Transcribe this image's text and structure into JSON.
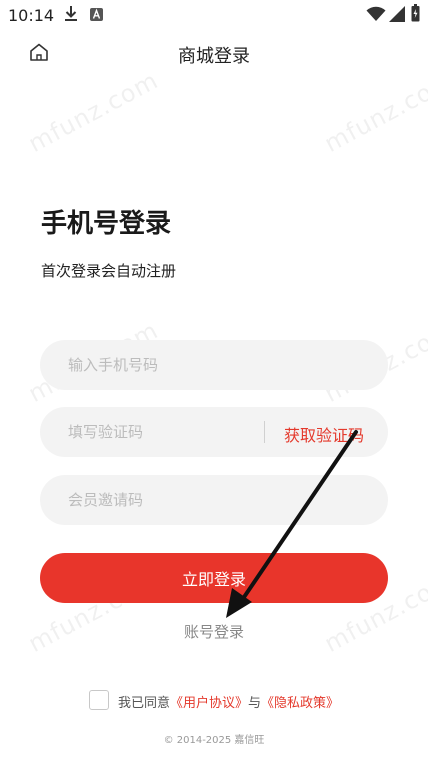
{
  "status_bar": {
    "time": "10:14",
    "icons": [
      "download-icon",
      "a-badge-icon",
      "wifi-icon",
      "signal-icon",
      "battery-icon"
    ]
  },
  "header": {
    "title": "商城登录",
    "home_icon": "home-icon"
  },
  "main": {
    "title": "手机号登录",
    "subtitle": "首次登录会自动注册"
  },
  "form": {
    "phone_placeholder": "输入手机号码",
    "code_placeholder": "填写验证码",
    "get_code_label": "获取验证码",
    "invite_placeholder": "会员邀请码"
  },
  "actions": {
    "login_label": "立即登录",
    "account_login_label": "账号登录"
  },
  "agreement": {
    "prefix": "我已同意",
    "user_agreement": "《用户协议》",
    "conjunction": "与",
    "privacy_policy": "《隐私政策》"
  },
  "footer": {
    "copyright": "© 2014-2025 嘉信旺"
  },
  "watermark": {
    "text": "mfunz.com"
  },
  "colors": {
    "accent": "#e8352b",
    "link": "#e4392c",
    "input_bg": "#f3f3f3",
    "placeholder": "#bcbcbc",
    "annotation_arrow": "#111111"
  }
}
